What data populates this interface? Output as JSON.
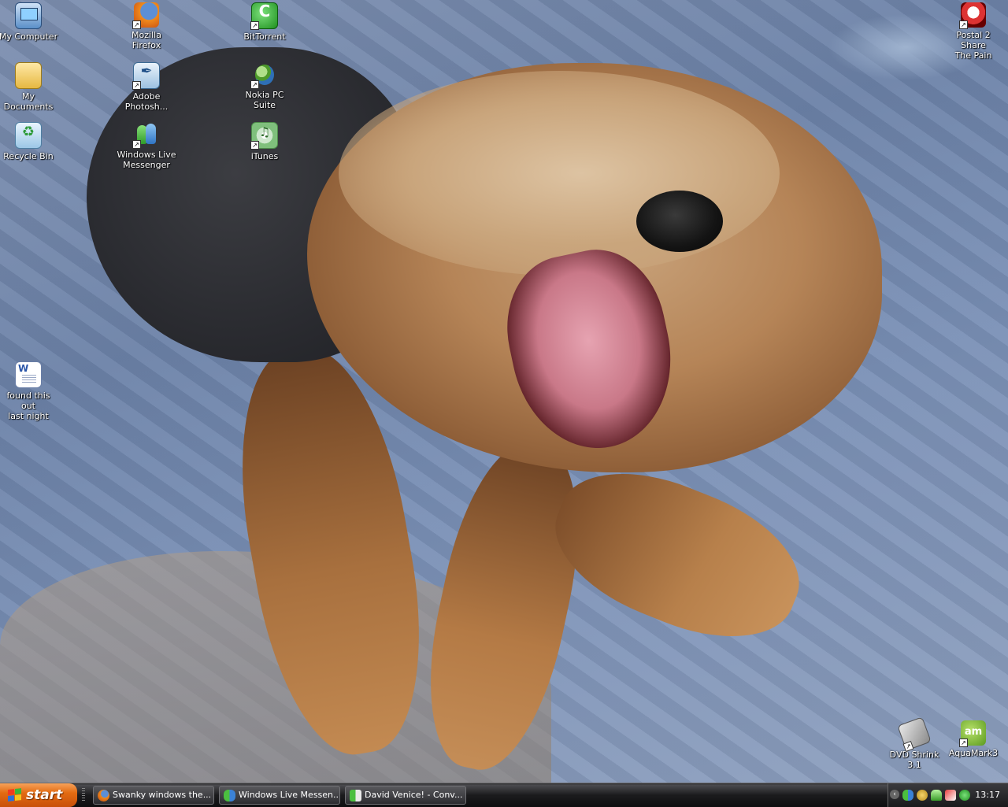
{
  "desktop": {
    "icons": {
      "my_computer": "My Computer",
      "my_documents": "My Documents",
      "recycle_bin": "Recycle Bin",
      "firefox": "Mozilla Firefox",
      "photoshop_line1": "Adobe",
      "photoshop_line2": "Photosh...",
      "messenger_line1": "Windows Live",
      "messenger_line2": "Messenger",
      "bittorrent": "BitTorrent",
      "nokia": "Nokia PC Suite",
      "itunes": "iTunes",
      "word_doc_line1": "found this out",
      "word_doc_line2": "last night",
      "postal_line1": "Postal 2 Share",
      "postal_line2": "The Pain",
      "dvd_shrink": "DVD Shrink 3.1",
      "aquamark": "AquaMark3"
    }
  },
  "taskbar": {
    "start_label": "start",
    "tasks": [
      {
        "label": "Swanky windows the...",
        "icon": "firefox-icon"
      },
      {
        "label": "Windows Live Messen...",
        "icon": "messenger-icon"
      },
      {
        "label": "David Venice! - Conv...",
        "icon": "conversation-icon"
      }
    ],
    "clock": "13:17"
  },
  "colors": {
    "start_button": "#e36b12",
    "taskbar": "#1b1b1d"
  }
}
